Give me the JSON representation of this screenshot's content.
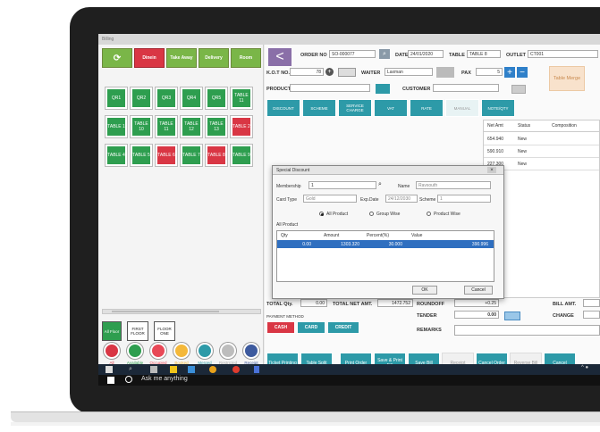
{
  "window": {
    "title": "Billing"
  },
  "left": {
    "top_buttons": [
      "Dinein",
      "Take Away",
      "Delivery",
      "Room"
    ],
    "tables_row1": [
      "QR1",
      "QR2",
      "QR3",
      "QR4",
      "QR5",
      "TABLE 11"
    ],
    "tables_row2": [
      "TABLE 1",
      "TABLE 10",
      "TABLE 11",
      "TABLE 12",
      "TABLE 13",
      "TABLE 2"
    ],
    "tables_row3": [
      "TABLE 4",
      "TABLE 5",
      "TABLE 6",
      "TABLE 7",
      "TABLE 8",
      "TABLE 9"
    ],
    "floors": [
      "All Floor",
      "FIRST FLOOR",
      "FLOOR ONE"
    ],
    "legend": [
      "All",
      "Available",
      "Occupied",
      "Booked",
      "Merged",
      "Restricted",
      "Receipt"
    ],
    "legend_colors": [
      "#d93644",
      "#2e9e4f",
      "#e84856",
      "#f4b83a",
      "#2d9aa8",
      "#bdbdbd",
      "#3d5a9e"
    ]
  },
  "order": {
    "order_no_label": "ORDER NO",
    "order_no": "SO-000077",
    "date_label": "DATE",
    "date": "24/01/2020",
    "table_label": "TABLE",
    "table": "TABLE 8",
    "outlet_label": "OUTLET",
    "outlet": "CT001",
    "kot_label": "K.O.T NO.",
    "kot_value": "78",
    "waiter_label": "WAITER",
    "waiter": "Laxman",
    "pax_label": "PAX",
    "pax": "5",
    "table_merge": "Table Merge",
    "product_label": "PRODUCT",
    "customer_label": "CUSTOMER"
  },
  "actions": [
    "DISCOUNT",
    "SCHEME",
    "SERVICE CHARGE",
    "VAT",
    "RATE",
    "MANUAL",
    "NOTE/QTY"
  ],
  "grid": {
    "headers": [
      "Net Amt",
      "Status",
      "Composition"
    ],
    "rows": [
      [
        "654.940",
        "New"
      ],
      [
        "590.910",
        "New"
      ],
      [
        "227.300",
        "New"
      ]
    ]
  },
  "dialog": {
    "title": "Special Discount",
    "membership_label": "Membership",
    "membership": "1",
    "name_label": "Name",
    "name": "Ravsouth",
    "card_type_label": "Card Type",
    "card_type": "Gold",
    "exp_label": "Exp.Date",
    "exp": "24/12/2030",
    "scheme_label": "Scheme",
    "scheme": "1",
    "radios": [
      "All Product",
      "Group Wise",
      "Product Wise"
    ],
    "section": "All Product",
    "cols": [
      "Qty",
      "Amount",
      "Percent(%)",
      "Value"
    ],
    "row": [
      "0.00",
      "1303.320",
      "30.000",
      "390.996"
    ],
    "ok": "OK",
    "cancel": "Cancel"
  },
  "totals": {
    "qty_label": "TOTAL Qty.",
    "qty": "0.00",
    "net_label": "TOTAL NET AMT.",
    "net": "1472.752",
    "roundoff_label": "ROUNDOFF",
    "roundoff": "+0.25",
    "bill_label": "BILL AMT.",
    "payment_label": "PAYMENT METHOD",
    "tender_label": "TENDER",
    "tender": "0.00",
    "change_label": "CHANGE",
    "remarks_label": "REMARKS",
    "pay_buttons": [
      "CASH",
      "CARD",
      "CREDIT"
    ]
  },
  "bottom_buttons": [
    "Ticket Printing",
    "Table Split",
    "Print Order",
    "Save & Print Bill",
    "Save Bill",
    "Receipt",
    "Cancel Order",
    "Reverse Bill",
    "Cancel"
  ],
  "taskbar": {
    "search_text": "Ask me anything"
  }
}
